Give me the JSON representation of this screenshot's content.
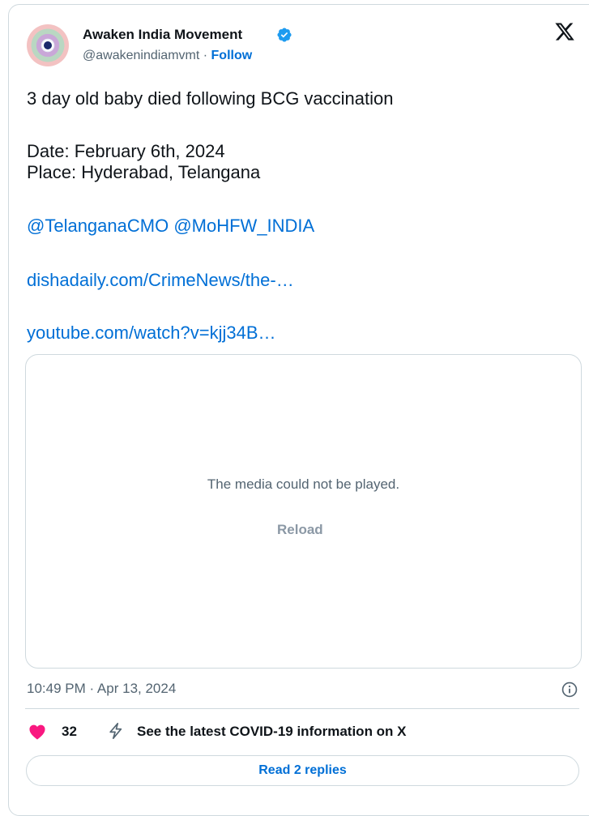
{
  "author": {
    "name": "Awaken India Movement",
    "handle": "@awakenindiamvmt",
    "separator": "·",
    "follow_label": "Follow"
  },
  "tweet": {
    "line1": "3 day old baby died following BCG vaccination",
    "date_line": "Date: February 6th, 2024",
    "place_line": "Place: Hyderabad, Telangana",
    "mention1": "@TelanganaCMO",
    "mention2": "@MoHFW_INDIA",
    "link1": "dishadaily.com/CrimeNews/the-…",
    "link2": "youtube.com/watch?v=kjj34B…"
  },
  "media": {
    "message": "The media could not be played.",
    "reload_label": "Reload"
  },
  "meta": {
    "timestamp": "10:49 PM · Apr 13, 2024"
  },
  "actions": {
    "likes": "32",
    "covid_label": "See the latest COVID-19 information on X",
    "replies_label": "Read 2 replies"
  },
  "icons": {
    "verified": "verified-badge-icon",
    "x": "x-logo-icon",
    "info": "info-icon",
    "heart": "heart-icon",
    "covid": "lightning-icon"
  },
  "colors": {
    "link": "#006fd6",
    "heart": "#f91880",
    "verified": "#1d9bf0",
    "text": "#0f1419",
    "muted": "#536471",
    "border": "#cfd9de"
  }
}
